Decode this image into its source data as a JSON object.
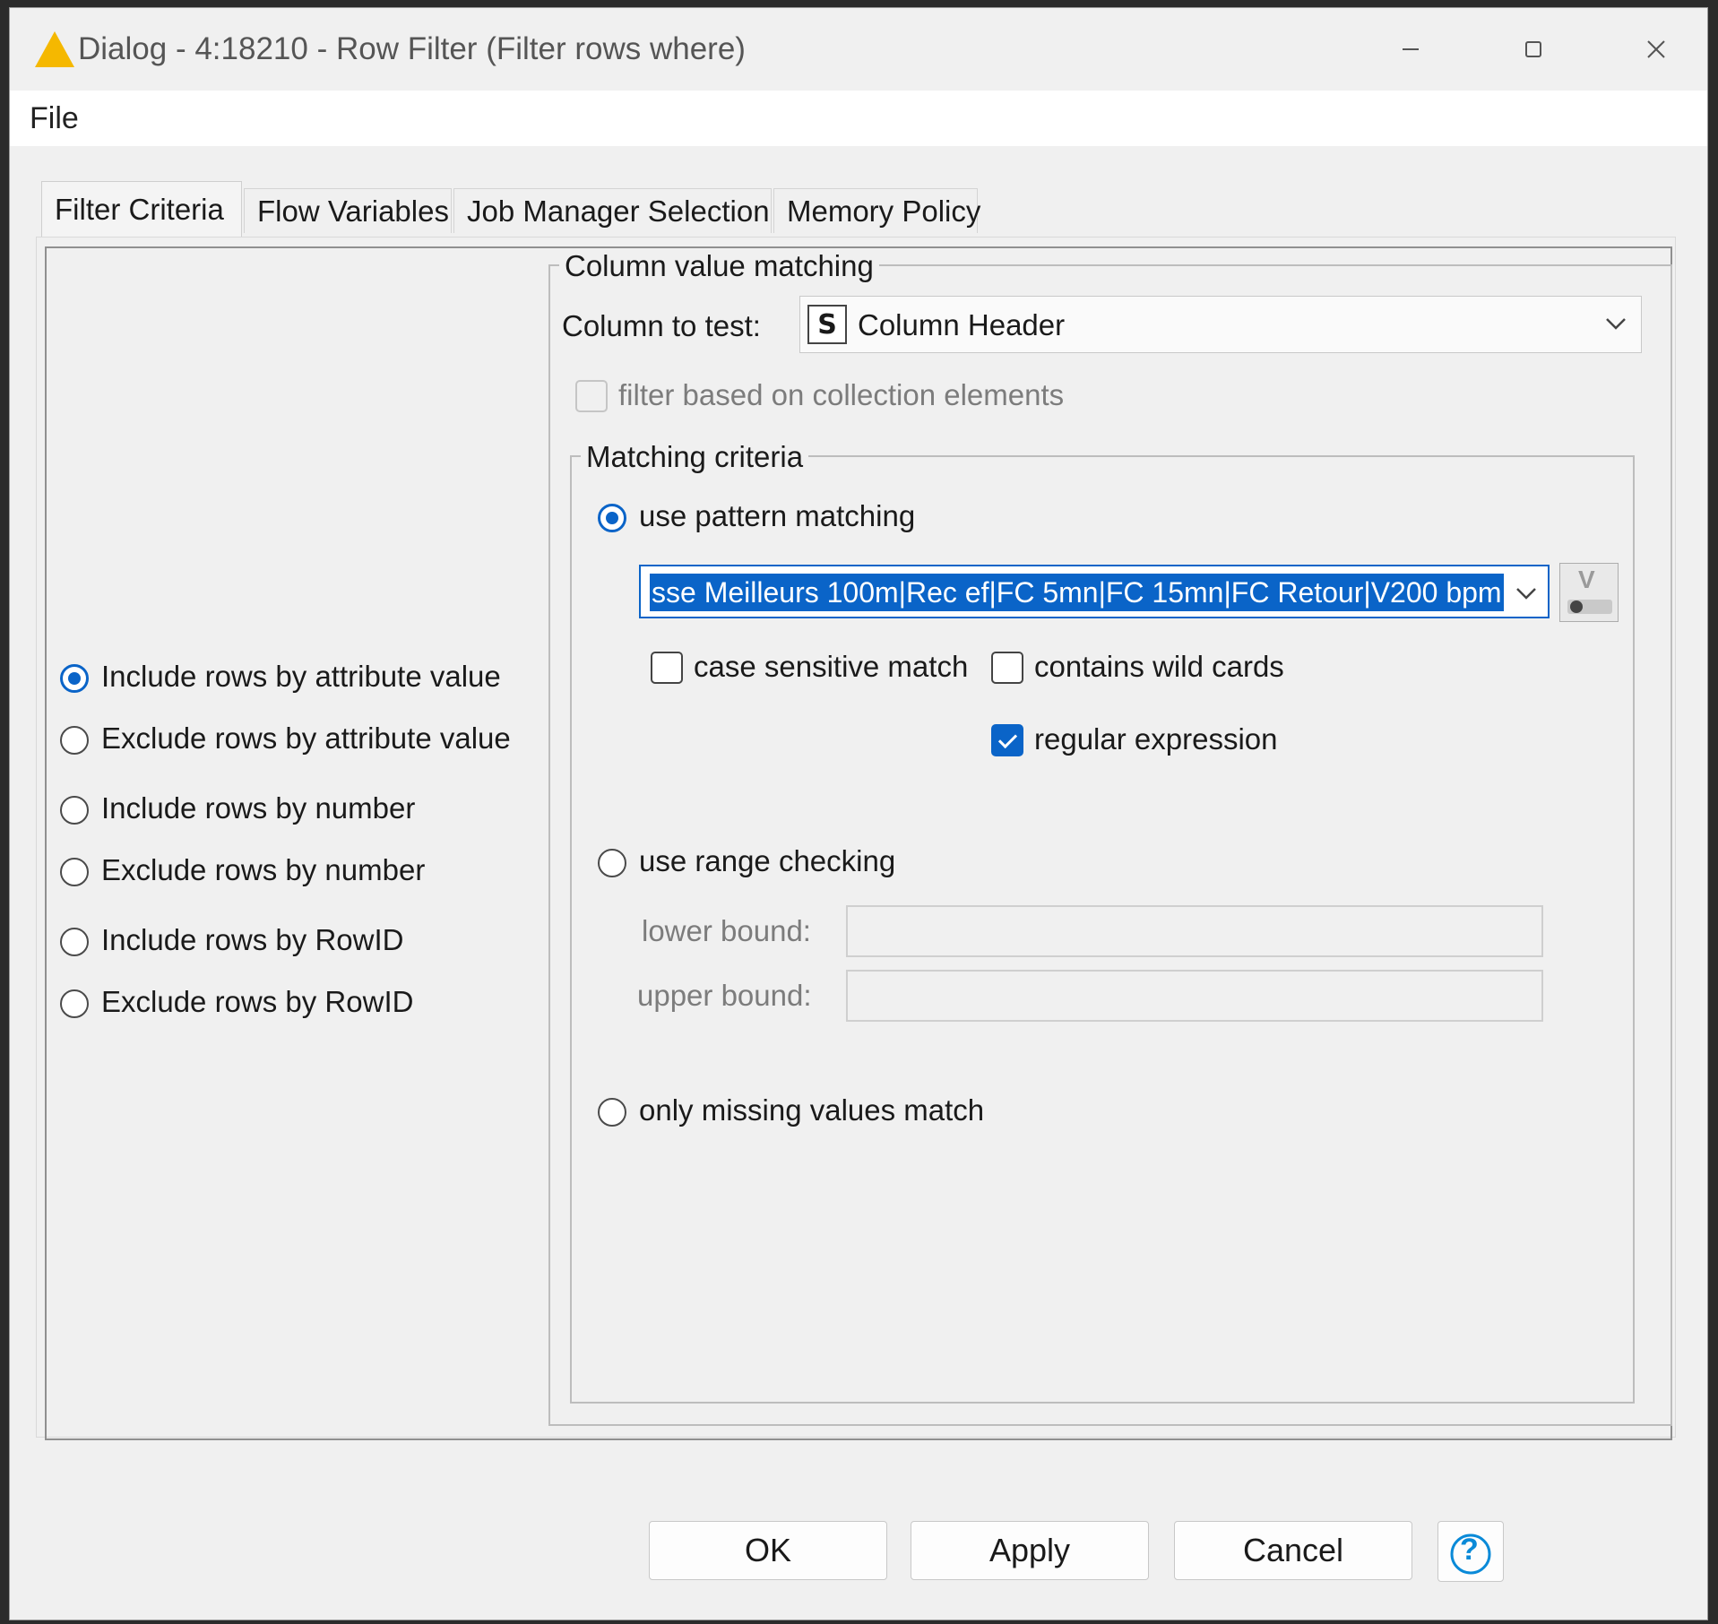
{
  "window": {
    "title": "Dialog - 4:18210 - Row Filter (Filter rows where)",
    "controls": {
      "minimize": "─",
      "maximize": "☐",
      "close": "✕"
    }
  },
  "menu": {
    "file": "File"
  },
  "tabs": [
    {
      "label": "Filter Criteria",
      "active": true
    },
    {
      "label": "Flow Variables",
      "active": false
    },
    {
      "label": "Job Manager Selection",
      "active": false
    },
    {
      "label": "Memory Policy",
      "active": false
    }
  ],
  "filter_modes": [
    {
      "label": "Include rows by attribute value",
      "selected": true
    },
    {
      "label": "Exclude rows by attribute value",
      "selected": false
    },
    {
      "label": "Include rows by number",
      "selected": false
    },
    {
      "label": "Exclude rows by number",
      "selected": false
    },
    {
      "label": "Include rows by RowID",
      "selected": false
    },
    {
      "label": "Exclude rows by RowID",
      "selected": false
    }
  ],
  "column_matching": {
    "group_title": "Column value matching",
    "column_label": "Column to test:",
    "column_type_badge": "S",
    "column_value": "Column Header",
    "collection_label": "filter based on collection elements",
    "collection_checked": false
  },
  "matching_criteria": {
    "group_title": "Matching criteria",
    "pattern_label": "use pattern matching",
    "pattern_value": "sse Meilleurs 100m|Rec ef|FC 5mn|FC 15mn|FC Retour|V200 bpm",
    "case_sensitive_label": "case sensitive match",
    "case_sensitive_checked": false,
    "wildcards_label": "contains wild cards",
    "wildcards_checked": false,
    "regex_label": "regular expression",
    "regex_checked": true,
    "range_label": "use range checking",
    "lower_bound_label": "lower bound:",
    "lower_bound_value": "",
    "upper_bound_label": "upper bound:",
    "upper_bound_value": "",
    "missing_label": "only missing values match",
    "var_button_letter": "V"
  },
  "buttons": {
    "ok": "OK",
    "apply": "Apply",
    "cancel": "Cancel",
    "help": "?"
  },
  "colors": {
    "accent": "#0a64c8",
    "warning": "#f5b800"
  }
}
